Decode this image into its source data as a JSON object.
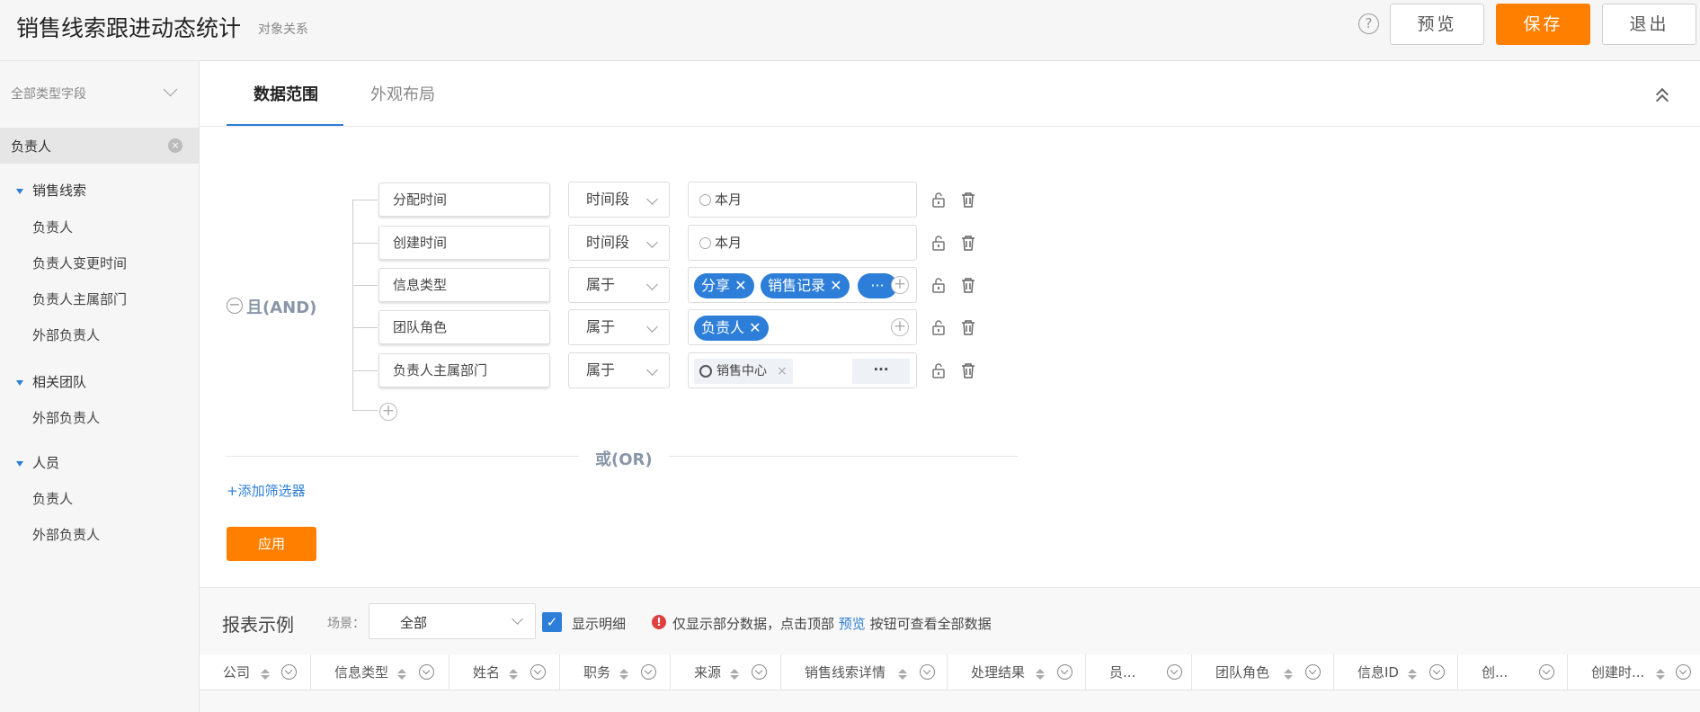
{
  "header": {
    "title": "销售线索跟进动态统计",
    "subtitle": "对象关系",
    "help": "?",
    "preview": "预览",
    "save": "保存",
    "exit": "退出",
    "save_color": "#ff8000"
  },
  "sidebar": {
    "filter_label": "全部类型字段",
    "search_value": "负责人",
    "groups": [
      {
        "label": "销售线索",
        "items": [
          "负责人",
          "负责人变更时间",
          "负责人主属部门",
          "外部负责人"
        ]
      },
      {
        "label": "相关团队",
        "items": [
          "外部负责人"
        ]
      },
      {
        "label": "人员",
        "items": [
          "负责人",
          "外部负责人"
        ]
      }
    ]
  },
  "tabs": [
    "数据范围",
    "外观布局"
  ],
  "filters": {
    "and_label": "且(AND)",
    "or_label": "或(OR)",
    "rows": [
      {
        "field": "分配时间",
        "op": "时间段",
        "value": "本月"
      },
      {
        "field": "创建时间",
        "op": "时间段",
        "value": "本月"
      },
      {
        "field": "信息类型",
        "op": "属于",
        "chips": [
          "分享",
          "销售记录"
        ],
        "more": "···"
      },
      {
        "field": "团队角色",
        "op": "属于",
        "chips": [
          "负责人"
        ]
      },
      {
        "field": "负责人主属部门",
        "op": "属于",
        "dept": "销售中心",
        "more": "···"
      }
    ],
    "add_filter": "+添加筛选器",
    "apply": "应用"
  },
  "report": {
    "title": "报表示例",
    "scene_label": "场景：",
    "scene_value": "全部",
    "show_detail": "显示明细",
    "notice_pre": "仅显示部分数据，点击顶部",
    "notice_link": "预览",
    "notice_post": "按钮可查看全部数据",
    "columns": [
      "公司",
      "信息类型",
      "姓名",
      "职务",
      "来源",
      "销售线索详情",
      "处理结果",
      "员...",
      "团队角色",
      "信息ID",
      "创...",
      "创建时..."
    ]
  },
  "colors": {
    "accent": "#2d7ed8",
    "orange": "#ff8000"
  }
}
